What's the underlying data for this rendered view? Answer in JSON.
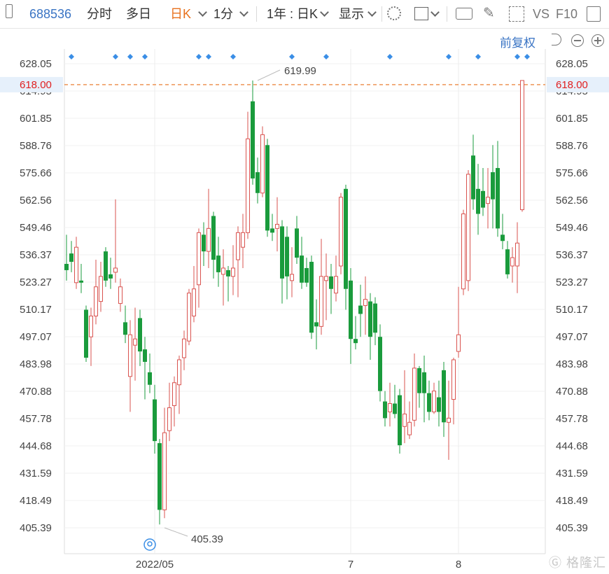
{
  "toolbar": {
    "code": "688536",
    "intraday": "分时",
    "multi_day": "多日",
    "daily_k": "日K",
    "one_min": "1分",
    "range": "1年 : 日K",
    "display": "显示",
    "vs": "VS",
    "f10": "F10"
  },
  "adjust_label": "前复权",
  "watermark": "格隆汇",
  "colors": {
    "up": "#d9534f",
    "down": "#1a9b3c",
    "current": "#e8711d",
    "marker": "#3a8ee6"
  },
  "chart_data": {
    "type": "candlestick",
    "y_ticks": [
      628.05,
      614.95,
      601.85,
      588.76,
      575.66,
      562.56,
      549.46,
      536.37,
      523.27,
      510.17,
      497.07,
      483.98,
      470.88,
      457.78,
      444.68,
      431.59,
      418.49,
      405.39
    ],
    "y_tick_labels": [
      "628.05",
      "614.95",
      "601.85",
      "588.76",
      "575.66",
      "562.56",
      "549.46",
      "536.37",
      "523.27",
      "510.17",
      "497.07",
      "483.98",
      "470.88",
      "457.78",
      "444.68",
      "431.59",
      "418.49",
      "405.39"
    ],
    "ylim": [
      400.5,
      633
    ],
    "x_labels": [
      {
        "label": "2022/05",
        "index": 18
      },
      {
        "label": "7",
        "index": 58
      },
      {
        "label": "8",
        "index": 80
      }
    ],
    "current_price": 618.0,
    "current_price_label": "618.00",
    "max_label": "619.99",
    "max_value": 619.99,
    "max_index": 39,
    "min_label": "405.39",
    "min_value": 405.39,
    "min_index": 20,
    "event_markers": [
      1,
      10,
      13,
      16,
      27,
      29,
      34,
      46,
      53,
      66,
      78,
      84,
      92,
      94
    ],
    "candles": [
      [
        532,
        529,
        546,
        524
      ],
      [
        537,
        533,
        543,
        528
      ],
      [
        523,
        540,
        545,
        520
      ],
      [
        524,
        523,
        532,
        518
      ],
      [
        510,
        487,
        512,
        485
      ],
      [
        497,
        507,
        511,
        483
      ],
      [
        507,
        521,
        534,
        503
      ],
      [
        514,
        526,
        533,
        509
      ],
      [
        538,
        524,
        540,
        521
      ],
      [
        527,
        525,
        535,
        520
      ],
      [
        528,
        530,
        563,
        523
      ],
      [
        513,
        521,
        525,
        509
      ],
      [
        504,
        498,
        512,
        494
      ],
      [
        478,
        498,
        505,
        461
      ],
      [
        493,
        496,
        511,
        476
      ],
      [
        506,
        490,
        510,
        483
      ],
      [
        491,
        485,
        497,
        467
      ],
      [
        480,
        474,
        489,
        470
      ],
      [
        467,
        447,
        474,
        441
      ],
      [
        446,
        414,
        448,
        407
      ],
      [
        414,
        451,
        463,
        410
      ],
      [
        452,
        463,
        475,
        447
      ],
      [
        464,
        475,
        478,
        454
      ],
      [
        474,
        486,
        488,
        460
      ],
      [
        487,
        496,
        500,
        481
      ],
      [
        495,
        518,
        520,
        493
      ],
      [
        507,
        520,
        531,
        504
      ],
      [
        522,
        547,
        549,
        511
      ],
      [
        546,
        538,
        552,
        531
      ],
      [
        538,
        549,
        568,
        530
      ],
      [
        555,
        534,
        557,
        525
      ],
      [
        536,
        528,
        545,
        521
      ],
      [
        527,
        530,
        539,
        512
      ],
      [
        529,
        526,
        531,
        514
      ],
      [
        526,
        530,
        541,
        517
      ],
      [
        534,
        547,
        550,
        516
      ],
      [
        540,
        547,
        556,
        530
      ],
      [
        547,
        592,
        605,
        544
      ],
      [
        610,
        573,
        620,
        570
      ],
      [
        576,
        566,
        583,
        561
      ],
      [
        566,
        594,
        598,
        564
      ],
      [
        589,
        548,
        592,
        545
      ],
      [
        549,
        547,
        556,
        543
      ],
      [
        549,
        551,
        564,
        538
      ],
      [
        550,
        525,
        553,
        513
      ],
      [
        545,
        526,
        550,
        515
      ],
      [
        524,
        527,
        540,
        516
      ],
      [
        549,
        535,
        555,
        532
      ],
      [
        536,
        523,
        545,
        520
      ],
      [
        530,
        523,
        535,
        521
      ],
      [
        533,
        499,
        536,
        496
      ],
      [
        504,
        502,
        515,
        491
      ],
      [
        502,
        526,
        544,
        498
      ],
      [
        524,
        526,
        537,
        505
      ],
      [
        526,
        520,
        532,
        508
      ],
      [
        518,
        526,
        536,
        514
      ],
      [
        531,
        564,
        566,
        527
      ],
      [
        568,
        520,
        570,
        510
      ],
      [
        524,
        496,
        530,
        484
      ],
      [
        496,
        494,
        507,
        491
      ],
      [
        512,
        508,
        522,
        497
      ],
      [
        512,
        515,
        526,
        498
      ],
      [
        514,
        497,
        518,
        486
      ],
      [
        513,
        499,
        516,
        493
      ],
      [
        497,
        471,
        503,
        466
      ],
      [
        466,
        458,
        471,
        454
      ],
      [
        461,
        465,
        475,
        454
      ],
      [
        465,
        460,
        474,
        458
      ],
      [
        469,
        445,
        472,
        441
      ],
      [
        454,
        460,
        481,
        446
      ],
      [
        450,
        456,
        466,
        448
      ],
      [
        457,
        482,
        489,
        454
      ],
      [
        482,
        470,
        483,
        463
      ],
      [
        480,
        470,
        488,
        456
      ],
      [
        470,
        461,
        476,
        457
      ],
      [
        461,
        471,
        475,
        460
      ],
      [
        468,
        461,
        476,
        454
      ],
      [
        481,
        456,
        485,
        449
      ],
      [
        456,
        458,
        476,
        438
      ],
      [
        467,
        486,
        487,
        455
      ],
      [
        490,
        498,
        521,
        487
      ],
      [
        520,
        556,
        558,
        517
      ],
      [
        524,
        575,
        577,
        519
      ],
      [
        584,
        563,
        594,
        558
      ],
      [
        568,
        556,
        580,
        546
      ],
      [
        567,
        559,
        578,
        555
      ],
      [
        561,
        564,
        578,
        549
      ],
      [
        576,
        563,
        589,
        549
      ],
      [
        578,
        549,
        591,
        545
      ],
      [
        546,
        543,
        556,
        539
      ],
      [
        539,
        527,
        543,
        525
      ],
      [
        531,
        535,
        540,
        523
      ],
      [
        531,
        542,
        552,
        518
      ],
      [
        558,
        619.99,
        620,
        557
      ]
    ]
  }
}
